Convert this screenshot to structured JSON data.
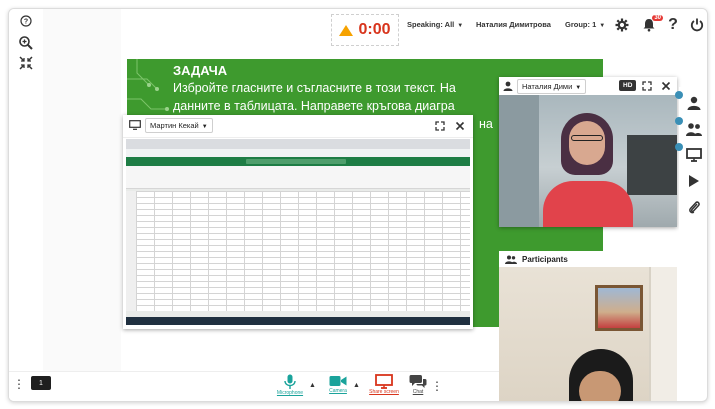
{
  "timer": "0:00",
  "topbar": {
    "speaking": "Speaking: All",
    "user_name": "Наталия Димитрова",
    "group": "Group: 1",
    "notification_count": "30"
  },
  "slide": {
    "title": "ЗАДАЧА",
    "line1": "Избройте гласните и съгласните в този текст. На",
    "line2": "данните в таблицата. Направете кръгова диагра",
    "line3": "на"
  },
  "screen_share": {
    "presenter": "Мартин Кекай"
  },
  "camera": {
    "name": "Наталия Дими",
    "quality": "HD"
  },
  "participants": {
    "title": "Participants"
  },
  "bottombar": {
    "page": "1",
    "microphone_label": "Microphone",
    "camera_label": "Camera",
    "share_label": "Share screen",
    "chat_label": "Chat"
  },
  "colors": {
    "slide_green": "#3e9a2e",
    "timer_red": "#d8341c",
    "accent_teal": "#1aa39b",
    "badge_red": "#e53935"
  }
}
